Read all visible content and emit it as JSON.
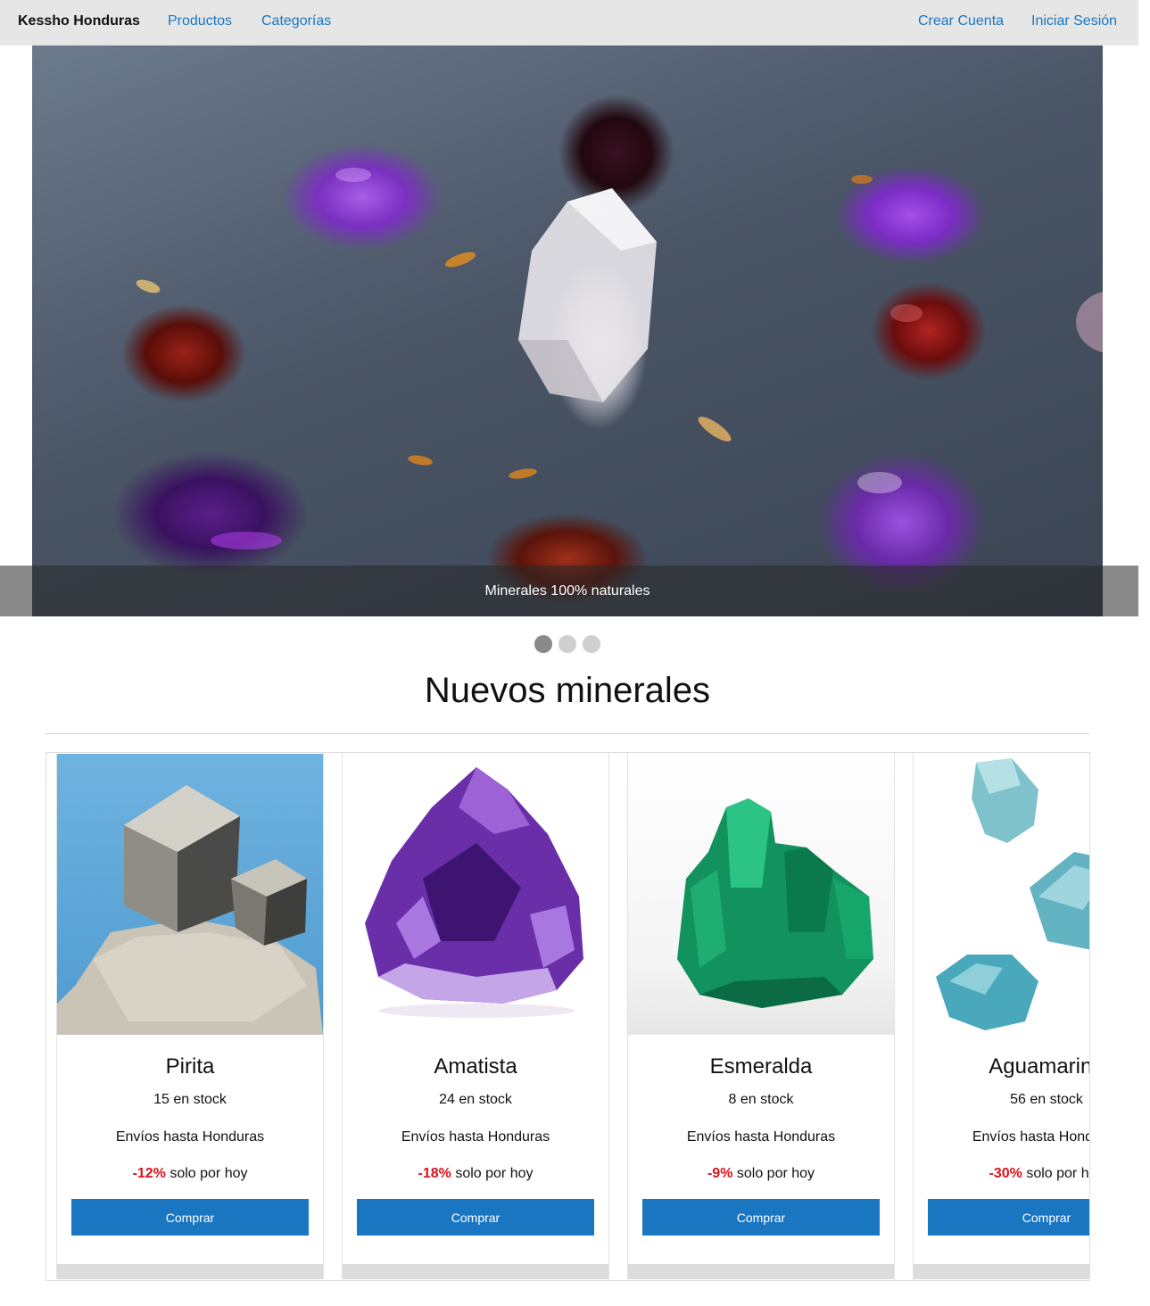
{
  "nav": {
    "brand": "Kessho Honduras",
    "links": [
      "Productos",
      "Categorías"
    ],
    "right_links": [
      "Crear Cuenta",
      "Iniciar Sesión"
    ]
  },
  "hero": {
    "caption": "Minerales 100% naturales",
    "slide_count": 3,
    "active_slide": 1
  },
  "section": {
    "title": "Nuevos minerales"
  },
  "products": [
    {
      "name": "Pirita",
      "stock": "15 en stock",
      "shipping": "Envíos hasta Honduras",
      "discount": "-12%",
      "promo_suffix": " solo por hoy",
      "button": "Comprar"
    },
    {
      "name": "Amatista",
      "stock": "24 en stock",
      "shipping": "Envíos hasta Honduras",
      "discount": "-18%",
      "promo_suffix": " solo por hoy",
      "button": "Comprar"
    },
    {
      "name": "Esmeralda",
      "stock": "8 en stock",
      "shipping": "Envíos hasta Honduras",
      "discount": "-9%",
      "promo_suffix": " solo por hoy",
      "button": "Comprar"
    },
    {
      "name": "Aguamarina",
      "stock": "56 en stock",
      "shipping": "Envíos hasta Honduras",
      "discount": "-30%",
      "promo_suffix": " solo por hoy",
      "button": "Comprar"
    }
  ],
  "colors": {
    "link": "#1a76c1",
    "button": "#1a76c1",
    "discount": "#e0101a",
    "navbar_bg": "#e6e6e6"
  }
}
